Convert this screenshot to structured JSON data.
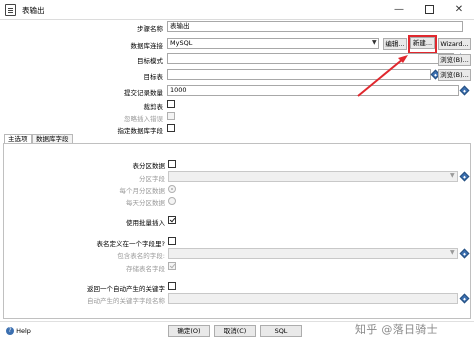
{
  "window": {
    "title": "表输出",
    "minimize": "—",
    "close": "✕"
  },
  "form": {
    "step_name_label": "步骤名称",
    "step_name_value": "表输出",
    "db_connection_label": "数据库连接",
    "db_connection_value": "MySQL",
    "edit_button": "编辑...",
    "new_button": "新建...",
    "wizard_button": "Wizard...",
    "target_schema_label": "目标模式",
    "target_schema_value": "",
    "browse_button": "浏览(B)...",
    "target_table_label": "目标表",
    "target_table_value": "",
    "commit_size_label": "提交记录数量",
    "commit_size_value": "1000",
    "truncate_label": "裁剪表",
    "ignore_errors_label": "忽略插入错误",
    "specify_fields_label": "指定数据库字段"
  },
  "tabs": [
    {
      "label": "主选项",
      "active": true
    },
    {
      "label": "数据库字段",
      "active": false
    }
  ],
  "main_options": {
    "partition_label": "表分区数据",
    "partition_field_label": "分区字段",
    "monthly_partition_label": "每个月分区数据",
    "daily_partition_label": "每天分区数据",
    "batch_insert_label": "使用批量插入",
    "batch_insert_checked": true,
    "table_in_field_label": "表名定义在一个字段里?",
    "table_name_field_label": "包含表名的字段:",
    "store_table_name_label": "存储表名字段",
    "store_table_name_checked": true,
    "return_key_label": "返回一个自动产生的关键字",
    "key_field_label": "自动产生的关键字字段名称"
  },
  "footer": {
    "help": "Help",
    "help_icon_glyph": "?",
    "ok": "确定(O)",
    "cancel": "取消(C)",
    "sql": "SQL",
    "watermark": "知乎 @落日骑士"
  },
  "annotation": {
    "highlight_color": "#e0282e"
  }
}
